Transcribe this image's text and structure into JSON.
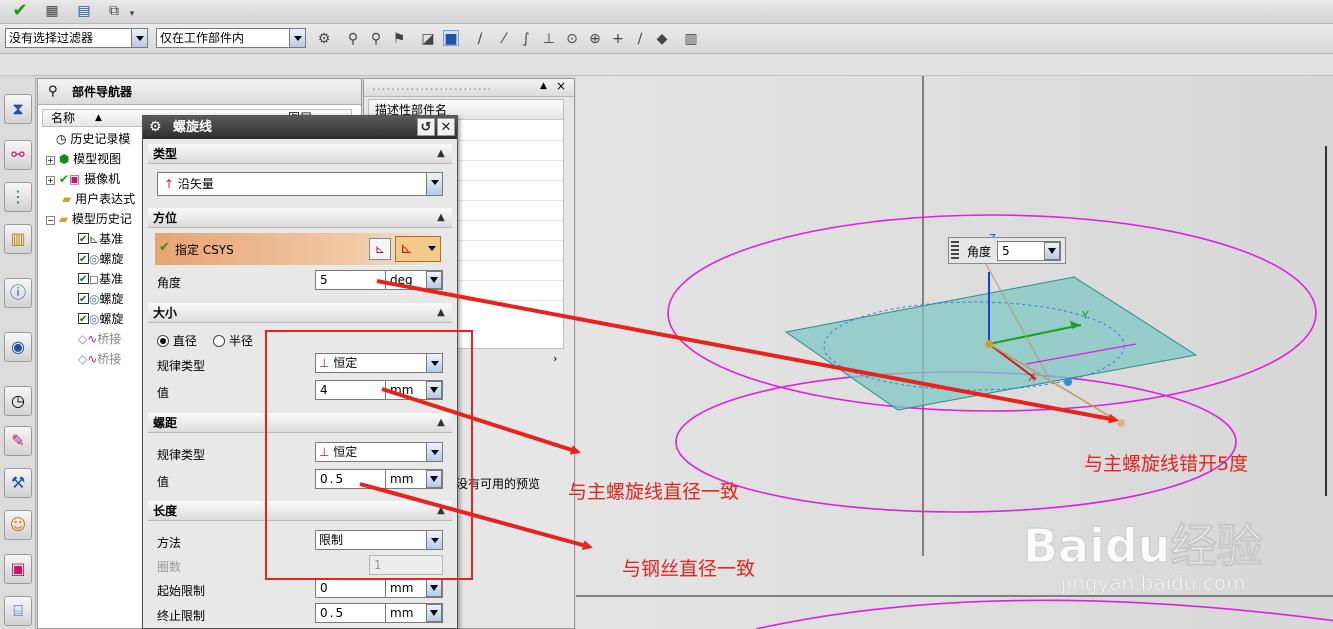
{
  "toolbar": {
    "filter_value": "没有选择过滤器",
    "scope_value": "仅在工作部件内"
  },
  "navigator": {
    "title": "部件导航器",
    "col_name": "名称",
    "col_layer": "图层",
    "items": [
      {
        "label": "历史记录模"
      },
      {
        "label": "模型视图"
      },
      {
        "label": "摄像机"
      },
      {
        "label": "用户表达式"
      },
      {
        "label": "模型历史记"
      },
      {
        "label": "基准"
      },
      {
        "label": "螺旋"
      },
      {
        "label": "基准"
      },
      {
        "label": "螺旋"
      },
      {
        "label": "螺旋"
      },
      {
        "label": "桥接"
      },
      {
        "label": "桥接"
      }
    ]
  },
  "side_panel": {
    "col_header": "描述性部件名",
    "preview_text": "没有可用的预览"
  },
  "dialog": {
    "title": "螺旋线",
    "type_section": "类型",
    "type_value": "沿矢量",
    "orient_section": "方位",
    "specify_csys": "指定 CSYS",
    "angle_label": "角度",
    "angle_value": "5",
    "angle_unit": "deg",
    "size_section": "大小",
    "diameter_label": "直径",
    "radius_label": "半径",
    "size_law_label": "规律类型",
    "size_law_value": "恒定",
    "size_value_label": "值",
    "size_value": "4",
    "size_unit": "mm",
    "pitch_section": "螺距",
    "pitch_law_label": "规律类型",
    "pitch_law_value": "恒定",
    "pitch_value_label": "值",
    "pitch_value": "0.5",
    "pitch_unit": "mm",
    "length_section": "长度",
    "method_label": "方法",
    "method_value": "限制",
    "turns_label": "圈数",
    "turns_value": "1",
    "start_label": "起始限制",
    "start_value": "0",
    "start_unit": "mm",
    "end_label": "终止限制",
    "end_value": "0.5",
    "end_unit": "mm"
  },
  "viewport": {
    "angle_popup_label": "角度",
    "angle_popup_value": "5",
    "axis_y": "Y",
    "axis_x": "X",
    "axis_z": "Z"
  },
  "annotations": {
    "diameter_note": "与主螺旋线直径一致",
    "wire_note": "与钢丝直径一致",
    "offset_note": "与主螺旋线错开5度",
    "watermark_brand": "Baidu经验",
    "watermark_url": "jingyan.baidu.com"
  },
  "colors": {
    "annotation_red": "#e8231d",
    "helix_magenta": "#e020e0",
    "plane_teal": "#7fc8c4",
    "csys_button_orange": "#e7a472"
  }
}
